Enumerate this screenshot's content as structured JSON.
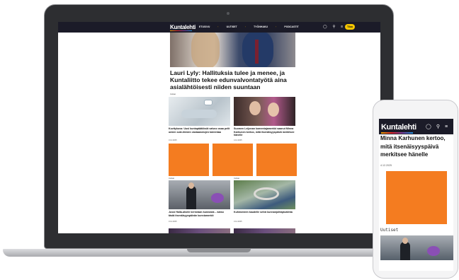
{
  "desktop": {
    "nav": {
      "logo": "Kuntalehti",
      "menu": [
        "ETUSIVU",
        "UUTISET",
        "TYÖNHAKU",
        "PODCASTIT"
      ],
      "icons": [
        "user-icon",
        "search-icon",
        "menu-icon"
      ],
      "subscribe": "Tilaa"
    },
    "headline": "Lauri Lyly: Hallituksia tulee ja menee, ja Kuntaliitto tekee edunvalvontatyötä aina asialähtöisesti niiden suuntaan",
    "headline_kicker": "Uutiset",
    "cards": [
      {
        "title": "Kuvitykuva: Uusi kuntapäätöksiä valvoo osaa pelit omien sote-tiimien vastaanotojen toimintaa",
        "date": "3.12.2025"
      },
      {
        "title": "Suomen Leijonan komentajamerkki saanut Minna Karhunen kertoo, mitä itsenäisyyspäivä merkitsee hänelle",
        "date": "4.12.2025"
      },
      {
        "title": "Jussi Halla-aholle kerrotaan kunnasta – katso tästä itsenäisyyspäivän kunniamerkit",
        "date": "3.12.2025",
        "kicker": "Uutiset"
      },
      {
        "title": "Kuhmoisten kaudelle selvä kunnanjohtajavalinta",
        "date": "3.12.2025",
        "kicker": "Uutiset"
      }
    ],
    "colors": {
      "nav_bg": "#1b1b28",
      "ad": "#f47c20",
      "subscribe": "#f6c700"
    }
  },
  "mobile": {
    "nav": {
      "logo": "Kuntalehti",
      "icons": [
        "user-icon",
        "search-icon",
        "menu-icon"
      ]
    },
    "headline": "Minna Karhunen kertoo, mitä itsenäisyyspäivä merkitsee hänelle",
    "date": "4.12.2025",
    "section": "Uutiset"
  }
}
